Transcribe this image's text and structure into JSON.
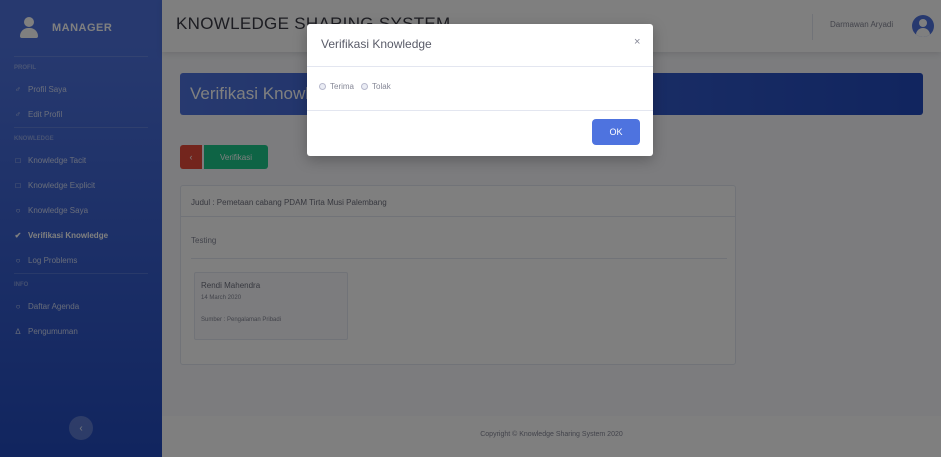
{
  "sidebar": {
    "brand": "MANAGER",
    "headings": [
      "Profil",
      "Knowledge",
      "Info"
    ],
    "items": [
      {
        "icon": "user-icon",
        "label": "Profil Saya",
        "glyph": "♂"
      },
      {
        "icon": "user-edit-icon",
        "label": "Edit Profil",
        "glyph": "♂"
      },
      {
        "icon": "file-icon",
        "label": "Knowledge Tacit",
        "glyph": "□"
      },
      {
        "icon": "file-icon",
        "label": "Knowledge Explicit",
        "glyph": "□"
      },
      {
        "icon": "clock-icon",
        "label": "Knowledge Saya",
        "glyph": "○"
      },
      {
        "icon": "check-circle-icon",
        "label": "Verifikasi Knowledge",
        "glyph": "✔",
        "active": true
      },
      {
        "icon": "clock-icon",
        "label": "Log Problems",
        "glyph": "○"
      },
      {
        "icon": "clock-icon",
        "label": "Daftar Agenda",
        "glyph": "○"
      },
      {
        "icon": "bullhorn-icon",
        "label": "Pengumuman",
        "glyph": "∆"
      }
    ],
    "toggle_glyph": "‹"
  },
  "topbar": {
    "title": "KNOWLEDGE SHARING SYSTEM",
    "user_name": "Darmawan Aryadi"
  },
  "main": {
    "page_title": "Verifikasi Knowledge",
    "back_glyph": "‹",
    "verify_label": "Verifikasi",
    "card": {
      "title": "Judul : Pemetaan cabang PDAM Tirta Musi Palembang",
      "body": "Testing",
      "author": "Rendi Mahendra",
      "date": "14 March 2020",
      "source": "Sumber : Pengalaman Pribadi"
    }
  },
  "footer": {
    "text": "Copyright © Knowledge Sharing System 2020"
  },
  "modal": {
    "title": "Verifikasi Knowledge",
    "close_glyph": "×",
    "options": [
      "Terima",
      "Tolak"
    ],
    "ok_label": "OK"
  }
}
